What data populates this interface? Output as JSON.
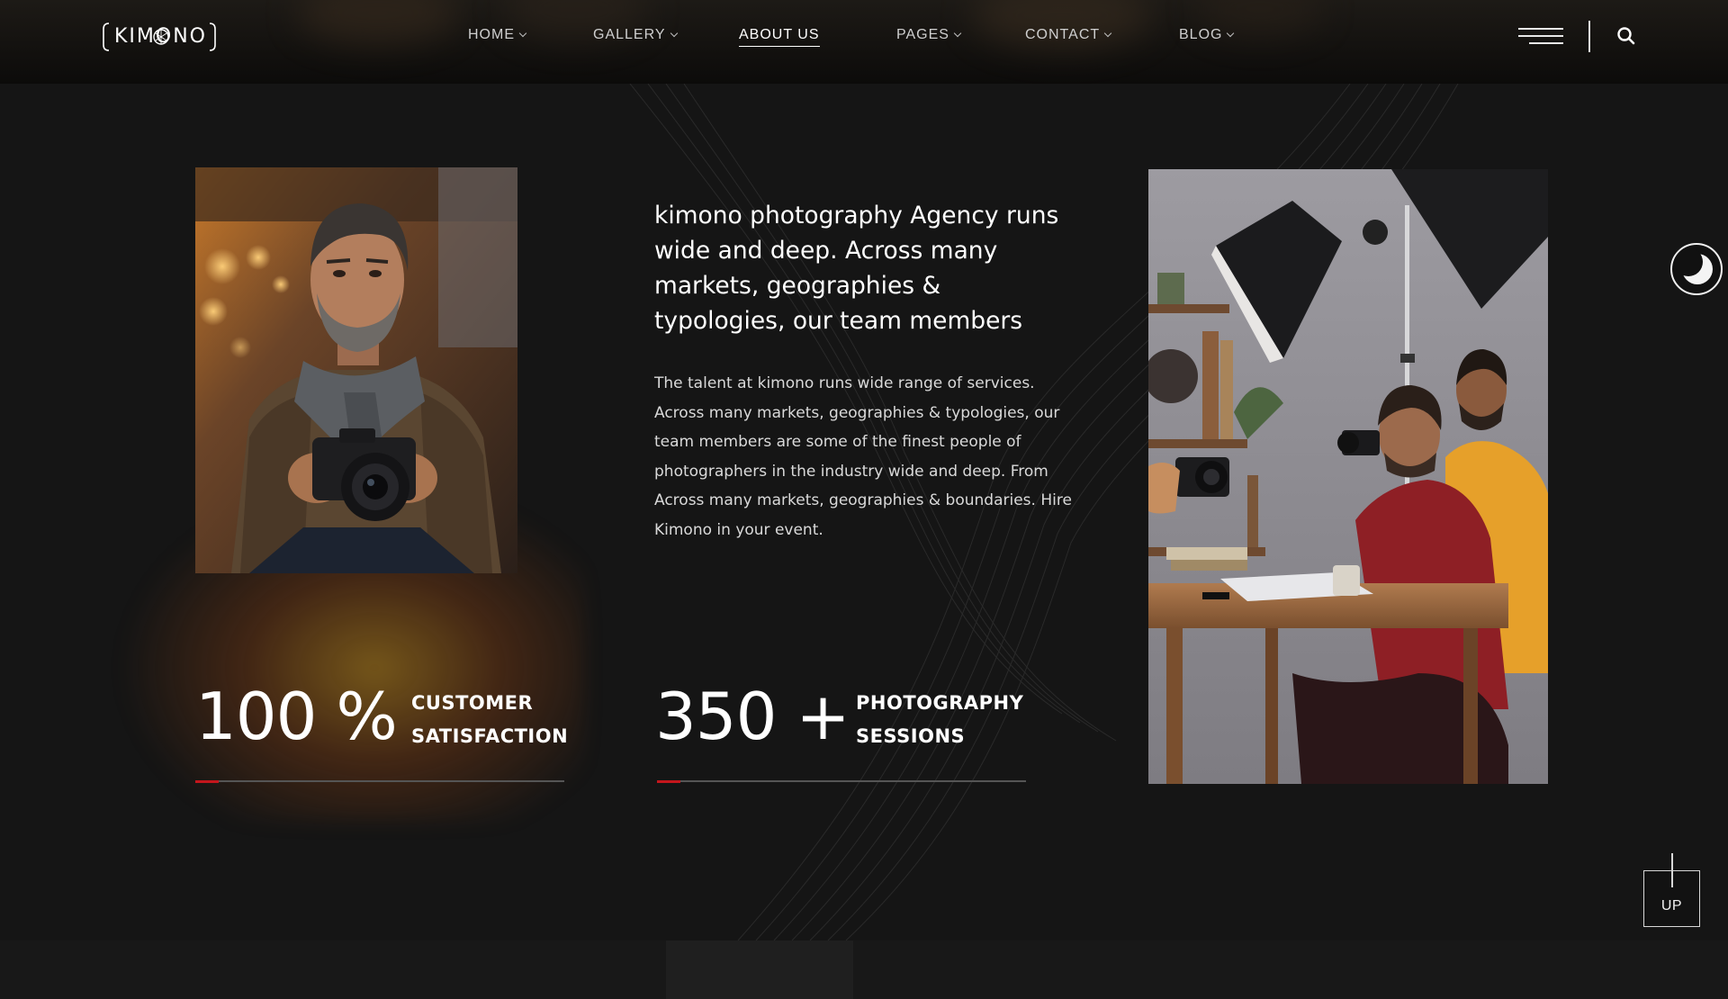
{
  "header": {
    "logo_text": "KIMONO",
    "nav": [
      {
        "label": "HOME",
        "has_dropdown": true,
        "active": false
      },
      {
        "label": "GALLERY",
        "has_dropdown": true,
        "active": false
      },
      {
        "label": "ABOUT US",
        "has_dropdown": false,
        "active": true
      },
      {
        "label": "PAGES",
        "has_dropdown": true,
        "active": false
      },
      {
        "label": "CONTACT",
        "has_dropdown": true,
        "active": false
      },
      {
        "label": "BLOG",
        "has_dropdown": true,
        "active": false
      }
    ],
    "menu_icon": "hamburger-icon",
    "search_icon": "search-icon"
  },
  "about": {
    "headline": "kimono photography Agency runs wide and deep. Across many markets, geographies & typologies, our team members",
    "body": "The talent at kimono runs wide range of services. Across many markets, geographies & typologies, our team members are some of the finest people of photographers in the industry wide and deep. From Across many markets, geographies & boundaries. Hire Kimono in your event.",
    "stats": [
      {
        "value": "100 %",
        "label_line1": "CUSTOMER",
        "label_line2": "SATISFACTION"
      },
      {
        "value": "350 +",
        "label_line1": "PHOTOGRAPHY",
        "label_line2": "SESSIONS"
      }
    ]
  },
  "floating": {
    "theme_toggle_icon": "moon-icon",
    "scroll_up_label": "UP"
  },
  "colors": {
    "background": "#151515",
    "accent_red": "#c4161c",
    "text": "#ffffff",
    "muted_text": "#d9d9d9"
  }
}
